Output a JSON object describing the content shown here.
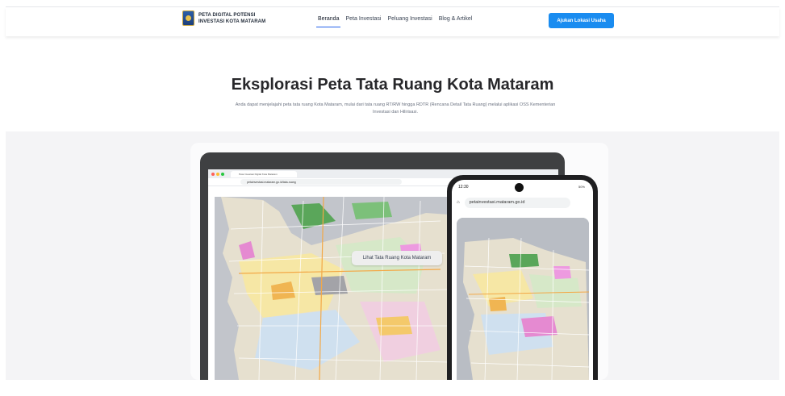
{
  "header": {
    "brand_line1": "PETA DIGITAL POTENSI",
    "brand_line2": "INVESTASI KOTA MATARAM",
    "nav": [
      {
        "label": "Beranda",
        "active": true
      },
      {
        "label": "Peta Investasi",
        "active": false
      },
      {
        "label": "Peluang Investasi",
        "active": false
      },
      {
        "label": "Blog & Artikel",
        "active": false
      }
    ],
    "cta_label": "Ajukan Lokasi Usaha"
  },
  "hero": {
    "title": "Eksplorasi Peta Tata Ruang Kota Mataram",
    "subtitle": "Anda dapat menjelajahi peta tata ruang Kota Mataram, mulai dari tata ruang RT/RW hingga RDTR (Rencana Detail Tata Ruang) melalui aplikasi OSS Kementerian Investasi dan Hilirisasi."
  },
  "laptop": {
    "tab_title": "Peta Investasi Digital Kota Mataram",
    "url": "petainvestasi.mataram.go.id/tata-ruang",
    "map_button": "Lihat Tata Ruang Kota Mataram"
  },
  "phone": {
    "time": "12:30",
    "battery": "50%",
    "url": "petainvestasi.mataram.go.id"
  },
  "colors": {
    "accent": "#1a8cf0",
    "active_underline": "#2563eb",
    "device_frame": "#3f4042",
    "phone_frame": "#1f1f21"
  }
}
